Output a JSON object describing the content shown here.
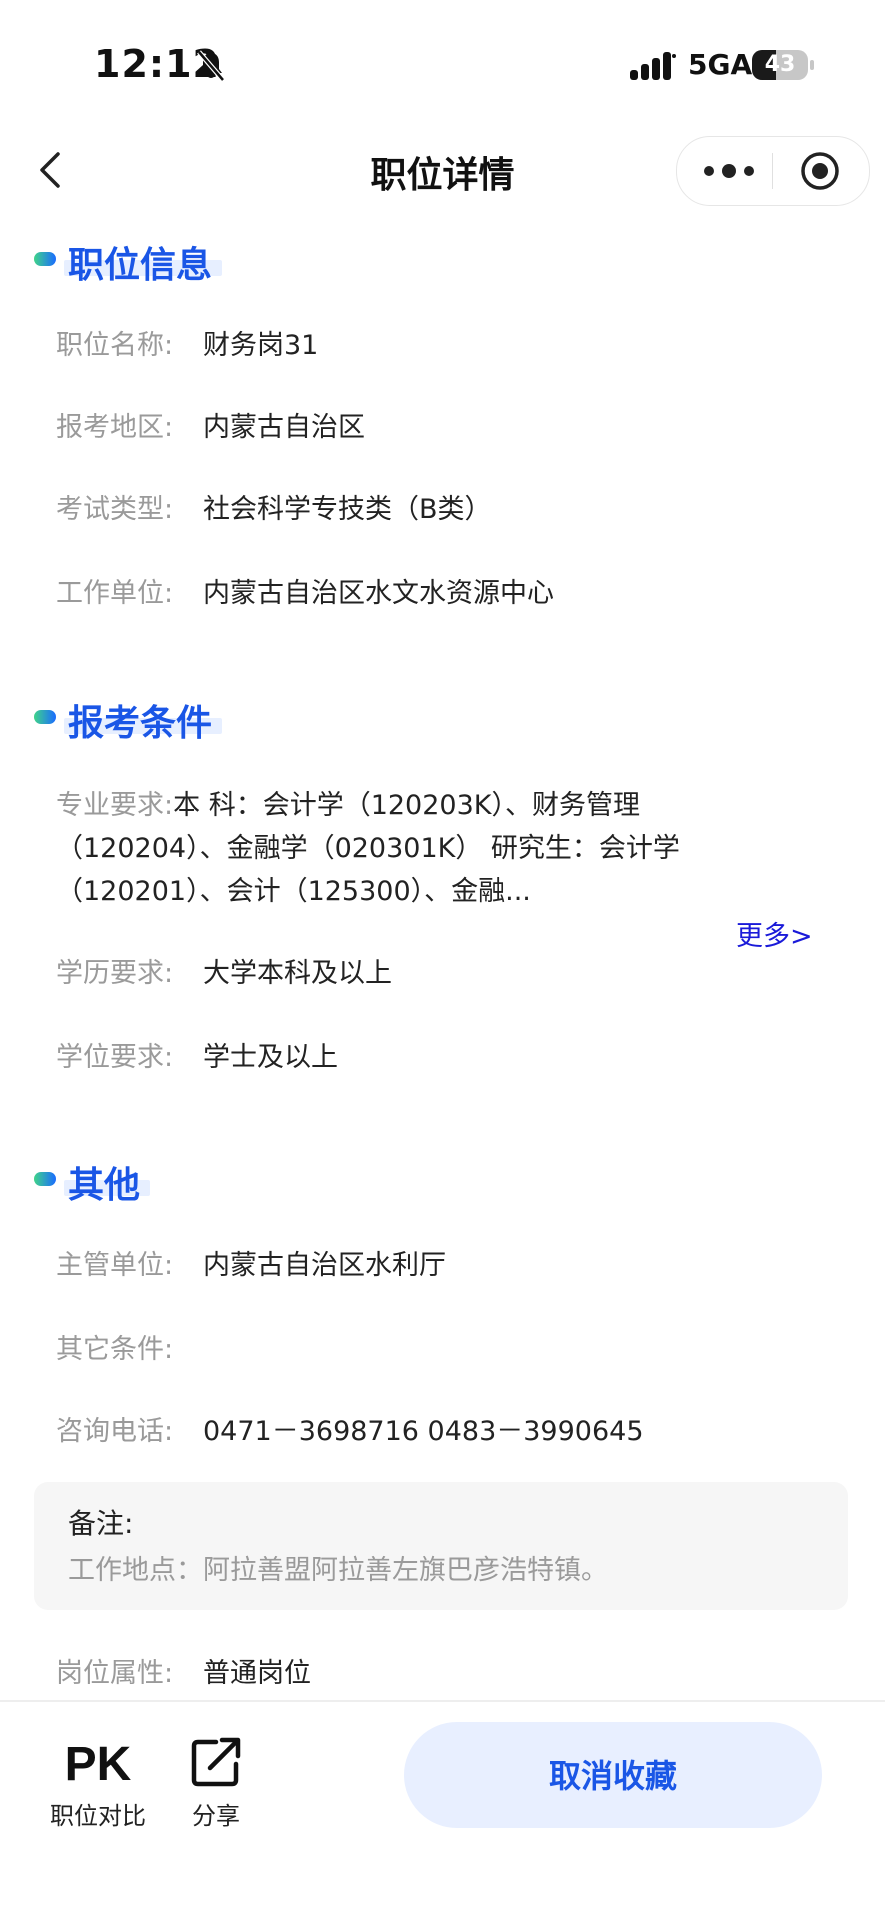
{
  "status_bar": {
    "time": "12:12",
    "network": "5GA",
    "battery_level": 43,
    "battery_text": "43",
    "icons": [
      "bell-muted-icon",
      "signal-icon",
      "battery-icon"
    ]
  },
  "nav": {
    "title": "职位详情",
    "icons": [
      "back-icon",
      "more-icon",
      "target-icon"
    ]
  },
  "sections": {
    "position_info": {
      "title": "职位信息",
      "rows": [
        {
          "label": "职位名称:",
          "value": "财务岗31"
        },
        {
          "label": "报考地区:",
          "value": "内蒙古自治区"
        },
        {
          "label": "考试类型:",
          "value": "社会科学专技类（B类）"
        },
        {
          "label": "工作单位:",
          "value": "内蒙古自治区水文水资源中心"
        }
      ]
    },
    "conditions": {
      "title": "报考条件",
      "major_label": "专业要求:",
      "major_value": "本 科：会计学（120203K）、财务管理（120204）、金融学（020301K） 研究生：会计学（120201）、会计（125300）、金融...",
      "more_link": "更多>",
      "rows": [
        {
          "label": "学历要求:",
          "value": "大学本科及以上"
        },
        {
          "label": "学位要求:",
          "value": "学士及以上"
        }
      ]
    },
    "other": {
      "title": "其他",
      "rows": [
        {
          "label": "主管单位:",
          "value": "内蒙古自治区水利厅"
        },
        {
          "label": "其它条件:",
          "value": ""
        },
        {
          "label": "咨询电话:",
          "value": "0471－3698716 0483－3990645"
        }
      ],
      "note_title": "备注:",
      "note_body": "工作地点：阿拉善盟阿拉善左旗巴彦浩特镇。",
      "attribute": {
        "label": "岗位属性:",
        "value": "普通岗位"
      }
    }
  },
  "bottom_bar": {
    "compare_label": "职位对比",
    "compare_icon_text": "PK",
    "share_label": "分享",
    "unfavorite_label": "取消收藏"
  },
  "colors": {
    "accent": "#1a56e6",
    "button_bg": "#e8efff",
    "label_gray": "#9a9a9a",
    "link_blue": "#1a1ad9"
  }
}
